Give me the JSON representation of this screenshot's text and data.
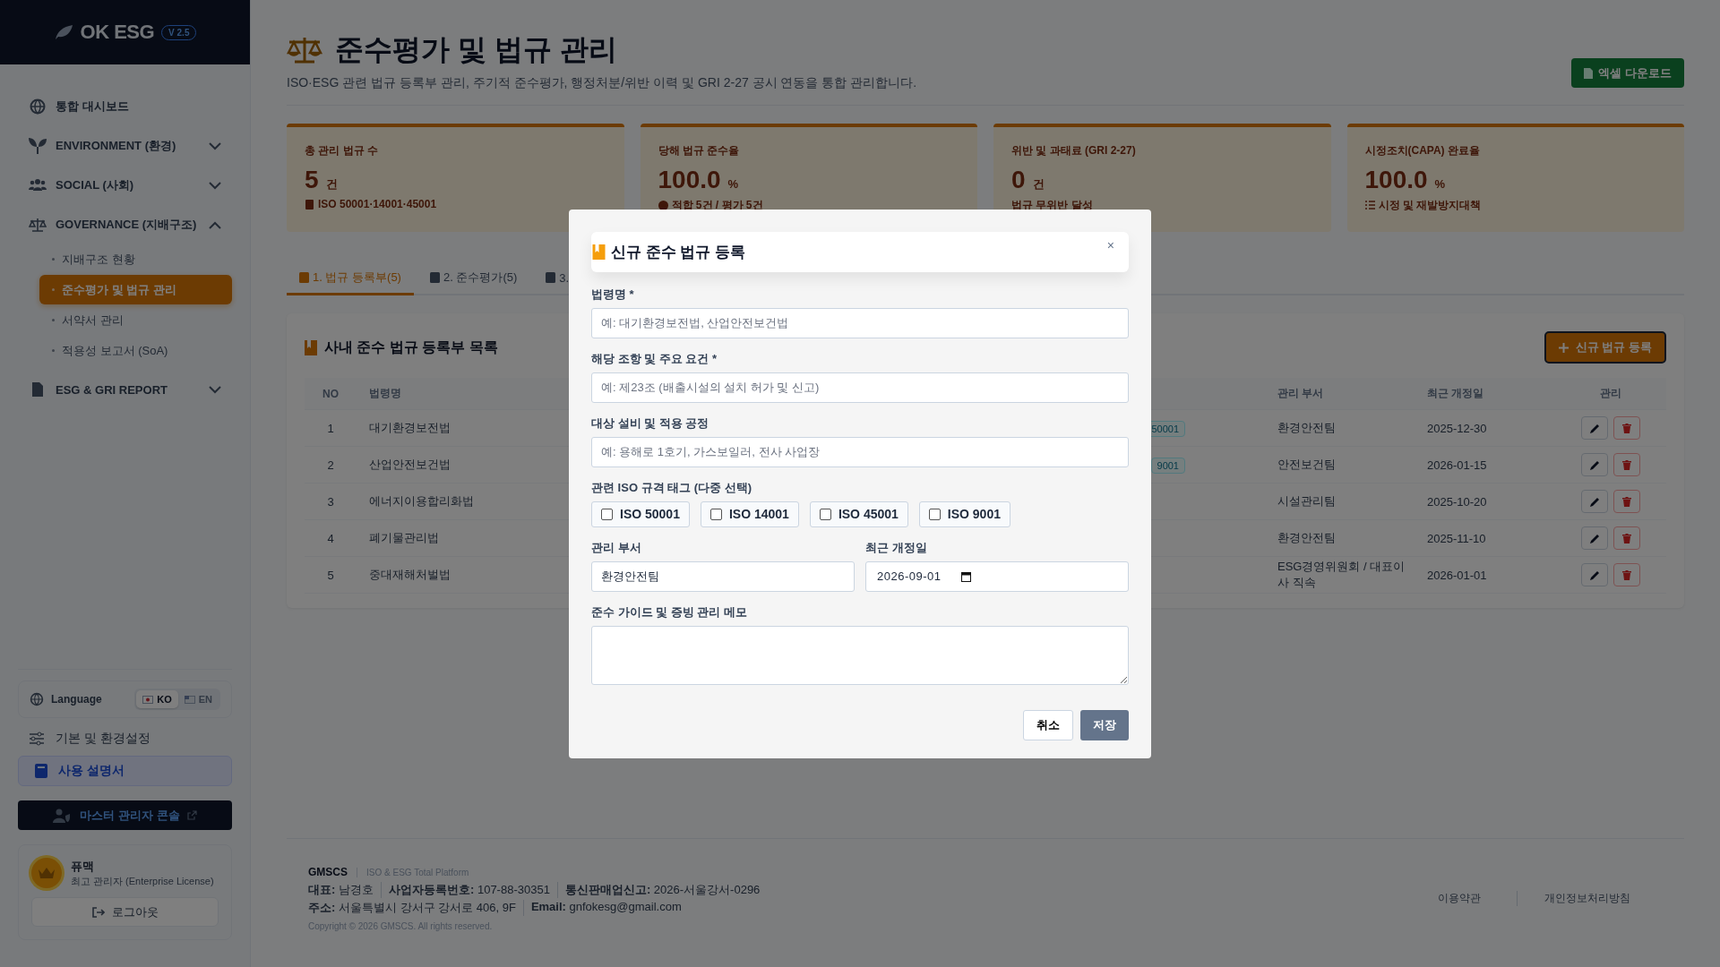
{
  "sidebar": {
    "logo": "OK ESG",
    "version": "V 2.5",
    "nav": [
      {
        "kind": "link",
        "label": "통합 대시보드"
      },
      {
        "kind": "group",
        "label": "ENVIRONMENT (환경)",
        "expanded": false
      },
      {
        "kind": "group",
        "label": "SOCIAL (사회)",
        "expanded": false
      },
      {
        "kind": "group",
        "label": "GOVERNANCE (지배구조)",
        "expanded": true,
        "children": [
          {
            "label": "지배구조 현황",
            "selected": false
          },
          {
            "label": "준수평가 및 법규 관리",
            "selected": true
          },
          {
            "label": "서약서 관리",
            "selected": false
          },
          {
            "label": "적용성 보고서 (SoA)",
            "selected": false
          }
        ]
      },
      {
        "kind": "group",
        "label": "ESG & GRI REPORT",
        "expanded": false
      }
    ],
    "language": {
      "label": "Language",
      "options": [
        {
          "label": "KO",
          "selected": true
        },
        {
          "label": "EN",
          "selected": false
        }
      ]
    },
    "settings": "기본 및 환경설정",
    "manual": "사용 설명서",
    "master_console": "마스터 관리자 콘솔",
    "user": {
      "name": "퓨맥",
      "role": "최고 관리자 (Enterprise License)"
    },
    "logout": "로그아웃"
  },
  "header": {
    "title": "준수평가 및 법규 관리",
    "subtitle": "ISO·ESG 관련 법규 등록부 관리, 주기적 준수평가, 행정처분/위반 이력 및 GRI 2-27 공시 연동을 통합 관리합니다.",
    "export_button": "엑셀 다운로드"
  },
  "stats": [
    {
      "label": "총 관리 법규 수",
      "value": "5",
      "unit": "건",
      "note": "ISO 50001·14001·45001"
    },
    {
      "label": "당해 법규 준수율",
      "value": "100.0",
      "unit": "%",
      "note": "적합 5건 / 평가 5건"
    },
    {
      "label": "위반 및 과태료 (GRI 2-27)",
      "value": "0",
      "unit": "건",
      "note": "법규 무위반 달성"
    },
    {
      "label": "시정조치(CAPA) 완료율",
      "value": "100.0",
      "unit": "%",
      "note": "시정 및 재발방지대책"
    }
  ],
  "tabs": [
    {
      "label": "1. 법규 등록부(5)",
      "selected": true
    },
    {
      "label": "2. 준수평가(5)",
      "selected": false
    },
    {
      "label": "3.",
      "selected": false
    }
  ],
  "table": {
    "title": "사내 준수 법규 등록부 목록",
    "add_button": "신규 법규 등록",
    "columns": [
      "NO",
      "법령명",
      "관리 부서",
      "최근 개정일",
      "관리"
    ],
    "rows": [
      {
        "no": "1",
        "name": "대기환경보전법",
        "tag": "50001",
        "dept": "환경안전팀",
        "date": "2025-12-30"
      },
      {
        "no": "2",
        "name": "산업안전보건법",
        "tag": "9001",
        "dept": "안전보건팀",
        "date": "2026-01-15"
      },
      {
        "no": "3",
        "name": "에너지이용합리화법",
        "dept": "시설관리팀",
        "date": "2025-10-20"
      },
      {
        "no": "4",
        "name": "폐기물관리법",
        "dept": "환경안전팀",
        "date": "2025-11-10"
      },
      {
        "no": "5",
        "name": "중대재해처벌법",
        "dept": "ESG경영위원회 / 대표이사 직속",
        "date": "2026-01-01"
      }
    ]
  },
  "footer": {
    "company": "GMSCS",
    "tagline": "ISO & ESG Total Platform",
    "line1": [
      {
        "key": "대표:",
        "value": "남경호"
      },
      {
        "key": "사업자등록번호:",
        "value": "107-88-30351"
      },
      {
        "key": "통신판매업신고:",
        "value": "2026-서울강서-0296"
      }
    ],
    "line2": [
      {
        "key": "주소:",
        "value": "서울특별시 강서구 강서로 406, 9F"
      },
      {
        "key": "Email:",
        "value": "gnfokesg@gmail.com"
      }
    ],
    "copyright": "Copyright © 2026 GMSCS. All rights reserved.",
    "links": [
      "이용약관",
      "개인정보처리방침"
    ]
  },
  "modal": {
    "title": "신규 준수 법규 등록",
    "close": "×",
    "law_label": "법령명 *",
    "law_placeholder": "예: 대기환경보전법, 산업안전보건법",
    "article_label": "해당 조항 및 주요 요건 *",
    "article_placeholder": "예: 제23조 (배출시설의 설치 허가 및 신고)",
    "target_label": "대상 설비 및 적용 공정",
    "target_placeholder": "예: 용해로 1호기, 가스보일러, 전사 사업장",
    "tags_label": "관련 ISO 규격 태그 (다중 선택)",
    "tags": [
      {
        "label": "ISO 50001",
        "checked": false
      },
      {
        "label": "ISO 14001",
        "checked": false
      },
      {
        "label": "ISO 45001",
        "checked": false
      },
      {
        "label": "ISO 9001",
        "checked": false
      }
    ],
    "dept_label": "관리 부서",
    "dept_value": "환경안전팀",
    "date_label": "최근 개정일",
    "date_value": "2026-09-01",
    "memo_label": "준수 가이드 및 증빙 관리 메모",
    "cancel": "취소",
    "save": "저장"
  }
}
